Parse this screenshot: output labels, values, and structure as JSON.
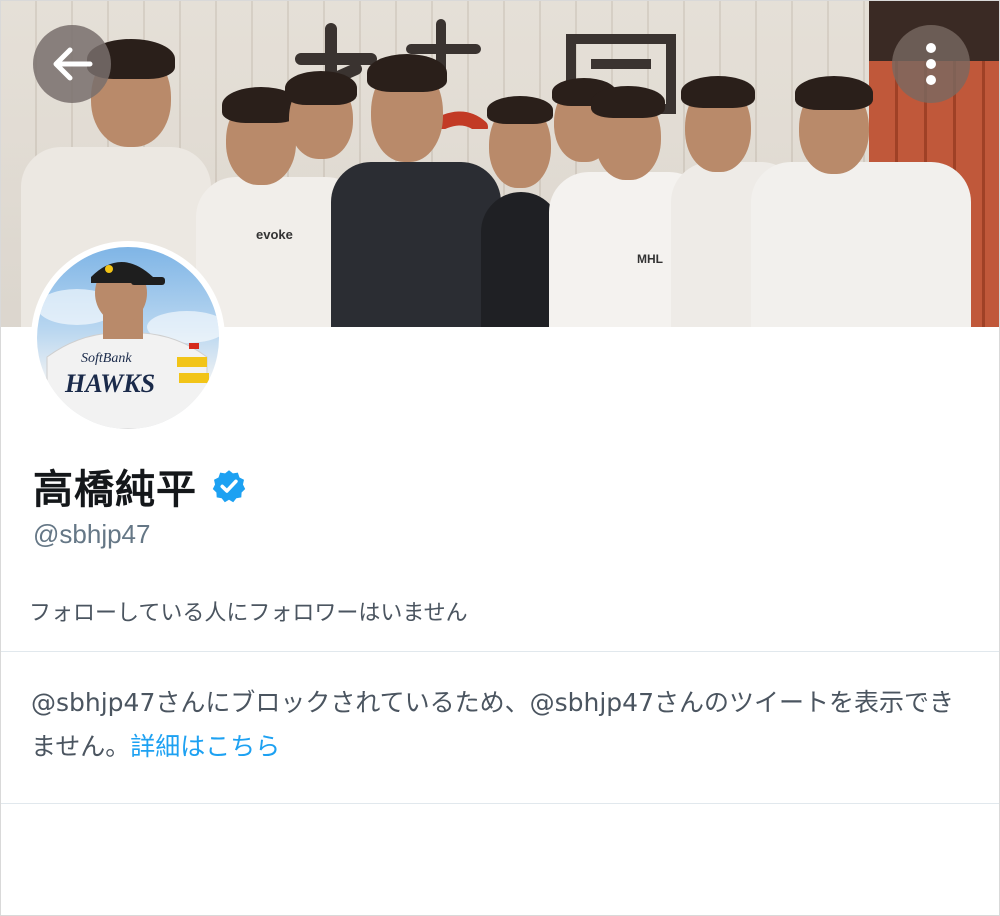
{
  "profile": {
    "display_name": "高橋純平",
    "handle": "@sbhjp47",
    "follow_info": "フォローしている人にフォロワーはいません",
    "verified": true
  },
  "blocked": {
    "message": "@sbhjp47さんにブロックされているため、@sbhjp47さんのツイートを表示できません。",
    "link_label": "詳細はこちら"
  },
  "banner": {
    "shirt_texts": [
      "evoke",
      "MHL"
    ]
  },
  "avatar": {
    "jersey_text_top": "SoftBank",
    "jersey_text_main": "HAWKS"
  },
  "icons": {
    "back": "back-arrow-icon",
    "more": "more-vertical-icon",
    "verified": "verified-badge-icon"
  },
  "colors": {
    "accent": "#1da1f2",
    "text_primary": "#14171a",
    "text_secondary": "#657786"
  }
}
